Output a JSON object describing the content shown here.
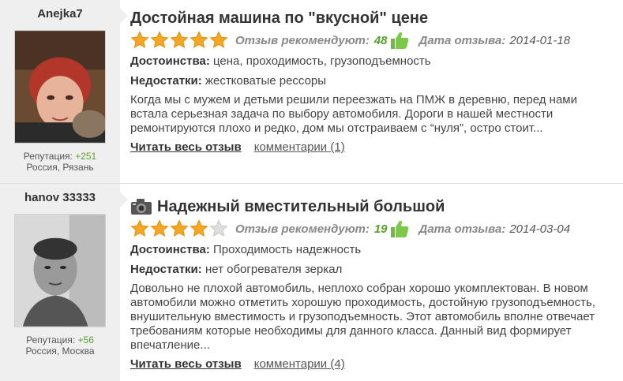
{
  "reviews": [
    {
      "user": "Anejka7",
      "reputation_label": "Репутация:",
      "reputation": "+251",
      "location": "Россия, Рязань",
      "title": "Достойная машина по \"вкусной\" цене",
      "has_photo": false,
      "rating": 5,
      "recommend_label": "Отзыв рекомендуют:",
      "recommend_count": "48",
      "date_label": "Дата отзыва:",
      "date": "2014-01-18",
      "pros_label": "Достоинства:",
      "pros": "цена, проходимость, грузоподъемность",
      "cons_label": "Недостатки:",
      "cons": "жестковатые рессоры",
      "text": "Когда мы с мужем и детьми решили переезжать на ПМЖ в деревню, перед нами встала серьезная задача по выбору автомобиля. Дороги в нашей местности ремонтируются плохо и редко, дом мы отстраиваем с “нуля”, остро стоит...",
      "read_more": "Читать весь отзыв",
      "comments": "комментарии (1)"
    },
    {
      "user": "hanov 33333",
      "reputation_label": "Репутация:",
      "reputation": "+56",
      "location": "Россия, Москва",
      "title": "Надежный вместительный большой",
      "has_photo": true,
      "rating": 4,
      "recommend_label": "Отзыв рекомендуют:",
      "recommend_count": "19",
      "date_label": "Дата отзыва:",
      "date": "2014-03-04",
      "pros_label": "Достоинства:",
      "pros": "Проходимость надежность",
      "cons_label": "Недостатки:",
      "cons": "нет обогревателя зеркал",
      "text": "Довольно не плохой автомобиль, неплохо собран хорошо укомплектован. В новом автомобили можно отметить хорошую проходимость, достойную грузоподъемность, внушительную вместимость и грузоподъемность. Этот автомобиль вполне отвечает требованиям которые необходимы для данного класса. Данный вид формирует впечатление...",
      "read_more": "Читать весь отзыв",
      "comments": "комментарии (4)"
    }
  ],
  "colors": {
    "star_filled": "#f5a623",
    "star_empty": "#dddddd",
    "accent_green": "#5aa02c",
    "sidebar_bg": "#efefef"
  },
  "icons": {
    "star": "star-icon",
    "thumb": "thumbs-up-icon",
    "camera": "camera-icon"
  }
}
